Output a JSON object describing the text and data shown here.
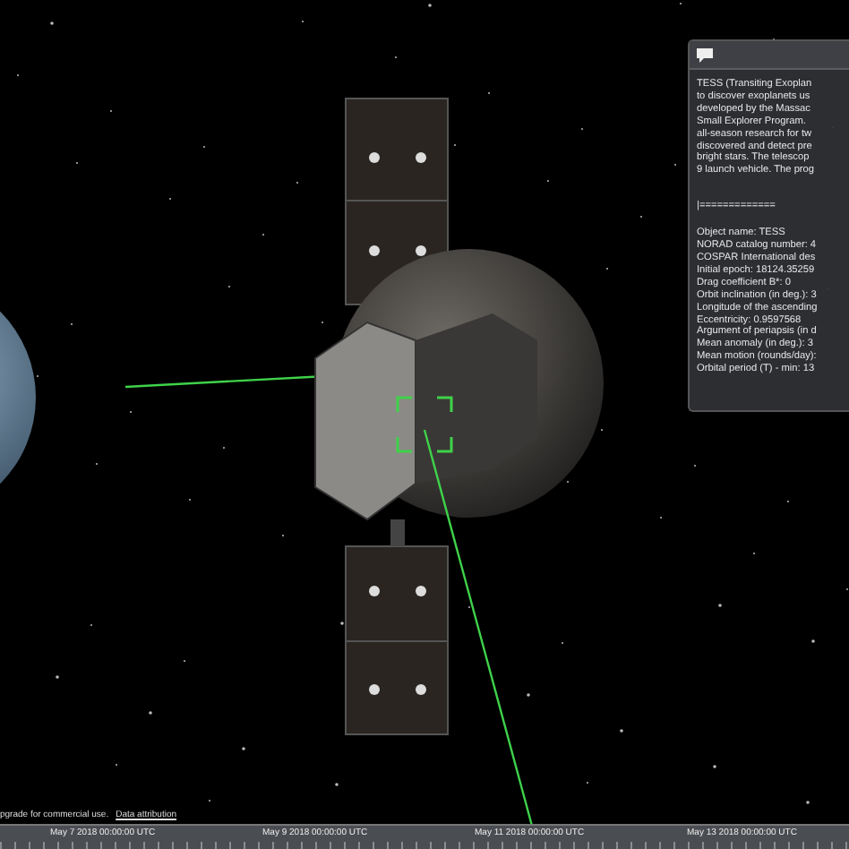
{
  "info_panel": {
    "description_lines": [
      "TESS (Transiting Exoplan",
      "to discover exoplanets us",
      "developed by the Massac",
      "Small Explorer Program.",
      "all-season research for tw",
      "discovered and detect pre",
      "bright stars. The telescop",
      "9 launch vehicle. The prog"
    ],
    "separator": "|=============",
    "detail_lines": [
      "Object name: TESS",
      "NORAD catalog number: 4",
      "COSPAR International des",
      "Initial epoch: 18124.35259",
      "Drag coefficient B*: 0",
      "Orbit inclination (in deg.): 3",
      "Longitude of the ascending",
      "Eccentricity: 0.9597568",
      "Argument of periapsis (in d",
      "Mean anomaly (in deg.): 3",
      "Mean motion (rounds/day):",
      "Orbital period (T) - min: 13"
    ]
  },
  "credits": {
    "notice": "pgrade for commercial use.",
    "link": "Data attribution"
  },
  "timeline": {
    "labels": [
      "May 7 2018 00:00:00 UTC",
      "May 9 2018 00:00:00 UTC",
      "May 11 2018 00:00:00 UTC",
      "May 13 2018 00:00:00 UTC"
    ]
  }
}
